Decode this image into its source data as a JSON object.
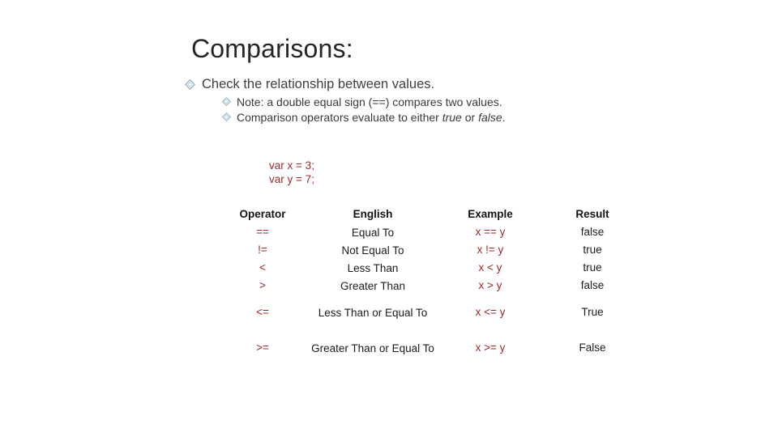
{
  "slide": {
    "title": "Comparisons:",
    "bullets": [
      {
        "level": 1,
        "icon": "diamond-bullet-icon",
        "text": "Check the relationship between values."
      },
      {
        "level": 2,
        "icon": "diamond-bullet-icon",
        "text": "Note: a double equal sign (==) compares two values."
      },
      {
        "level": 2,
        "icon": "diamond-bullet-icon",
        "text_before": "Comparison operators evaluate to either ",
        "italic_1": "true",
        "text_middle": " or ",
        "italic_2": "false",
        "text_after": "."
      }
    ],
    "code": {
      "line1": "var x = 3;",
      "line2": "var y = 7;"
    },
    "table": {
      "headers": {
        "operator": "Operator",
        "english": "English",
        "example": "Example",
        "result": "Result"
      },
      "rows": [
        {
          "operator": "==",
          "english": "Equal To",
          "example": "x == y",
          "result": "false"
        },
        {
          "operator": "!=",
          "english": "Not Equal To",
          "example": "x != y",
          "result": "true"
        },
        {
          "operator": "<",
          "english": "Less Than",
          "example": "x < y",
          "result": "true"
        },
        {
          "operator": ">",
          "english": "Greater Than",
          "example": "x > y",
          "result": "false"
        },
        {
          "operator": "<=",
          "english": "Less Than or Equal To",
          "example": "x <= y",
          "result": "True"
        },
        {
          "operator": ">=",
          "english": "Greater Than or Equal To",
          "example": "x >= y",
          "result": "False"
        }
      ]
    }
  },
  "colors": {
    "background": "#ffffff",
    "title": "#262626",
    "body_text": "#3f3f3f",
    "code_red": "#9c2b2b",
    "table_red": "#a32727",
    "bullet_diamond": "#8aa9bd"
  }
}
